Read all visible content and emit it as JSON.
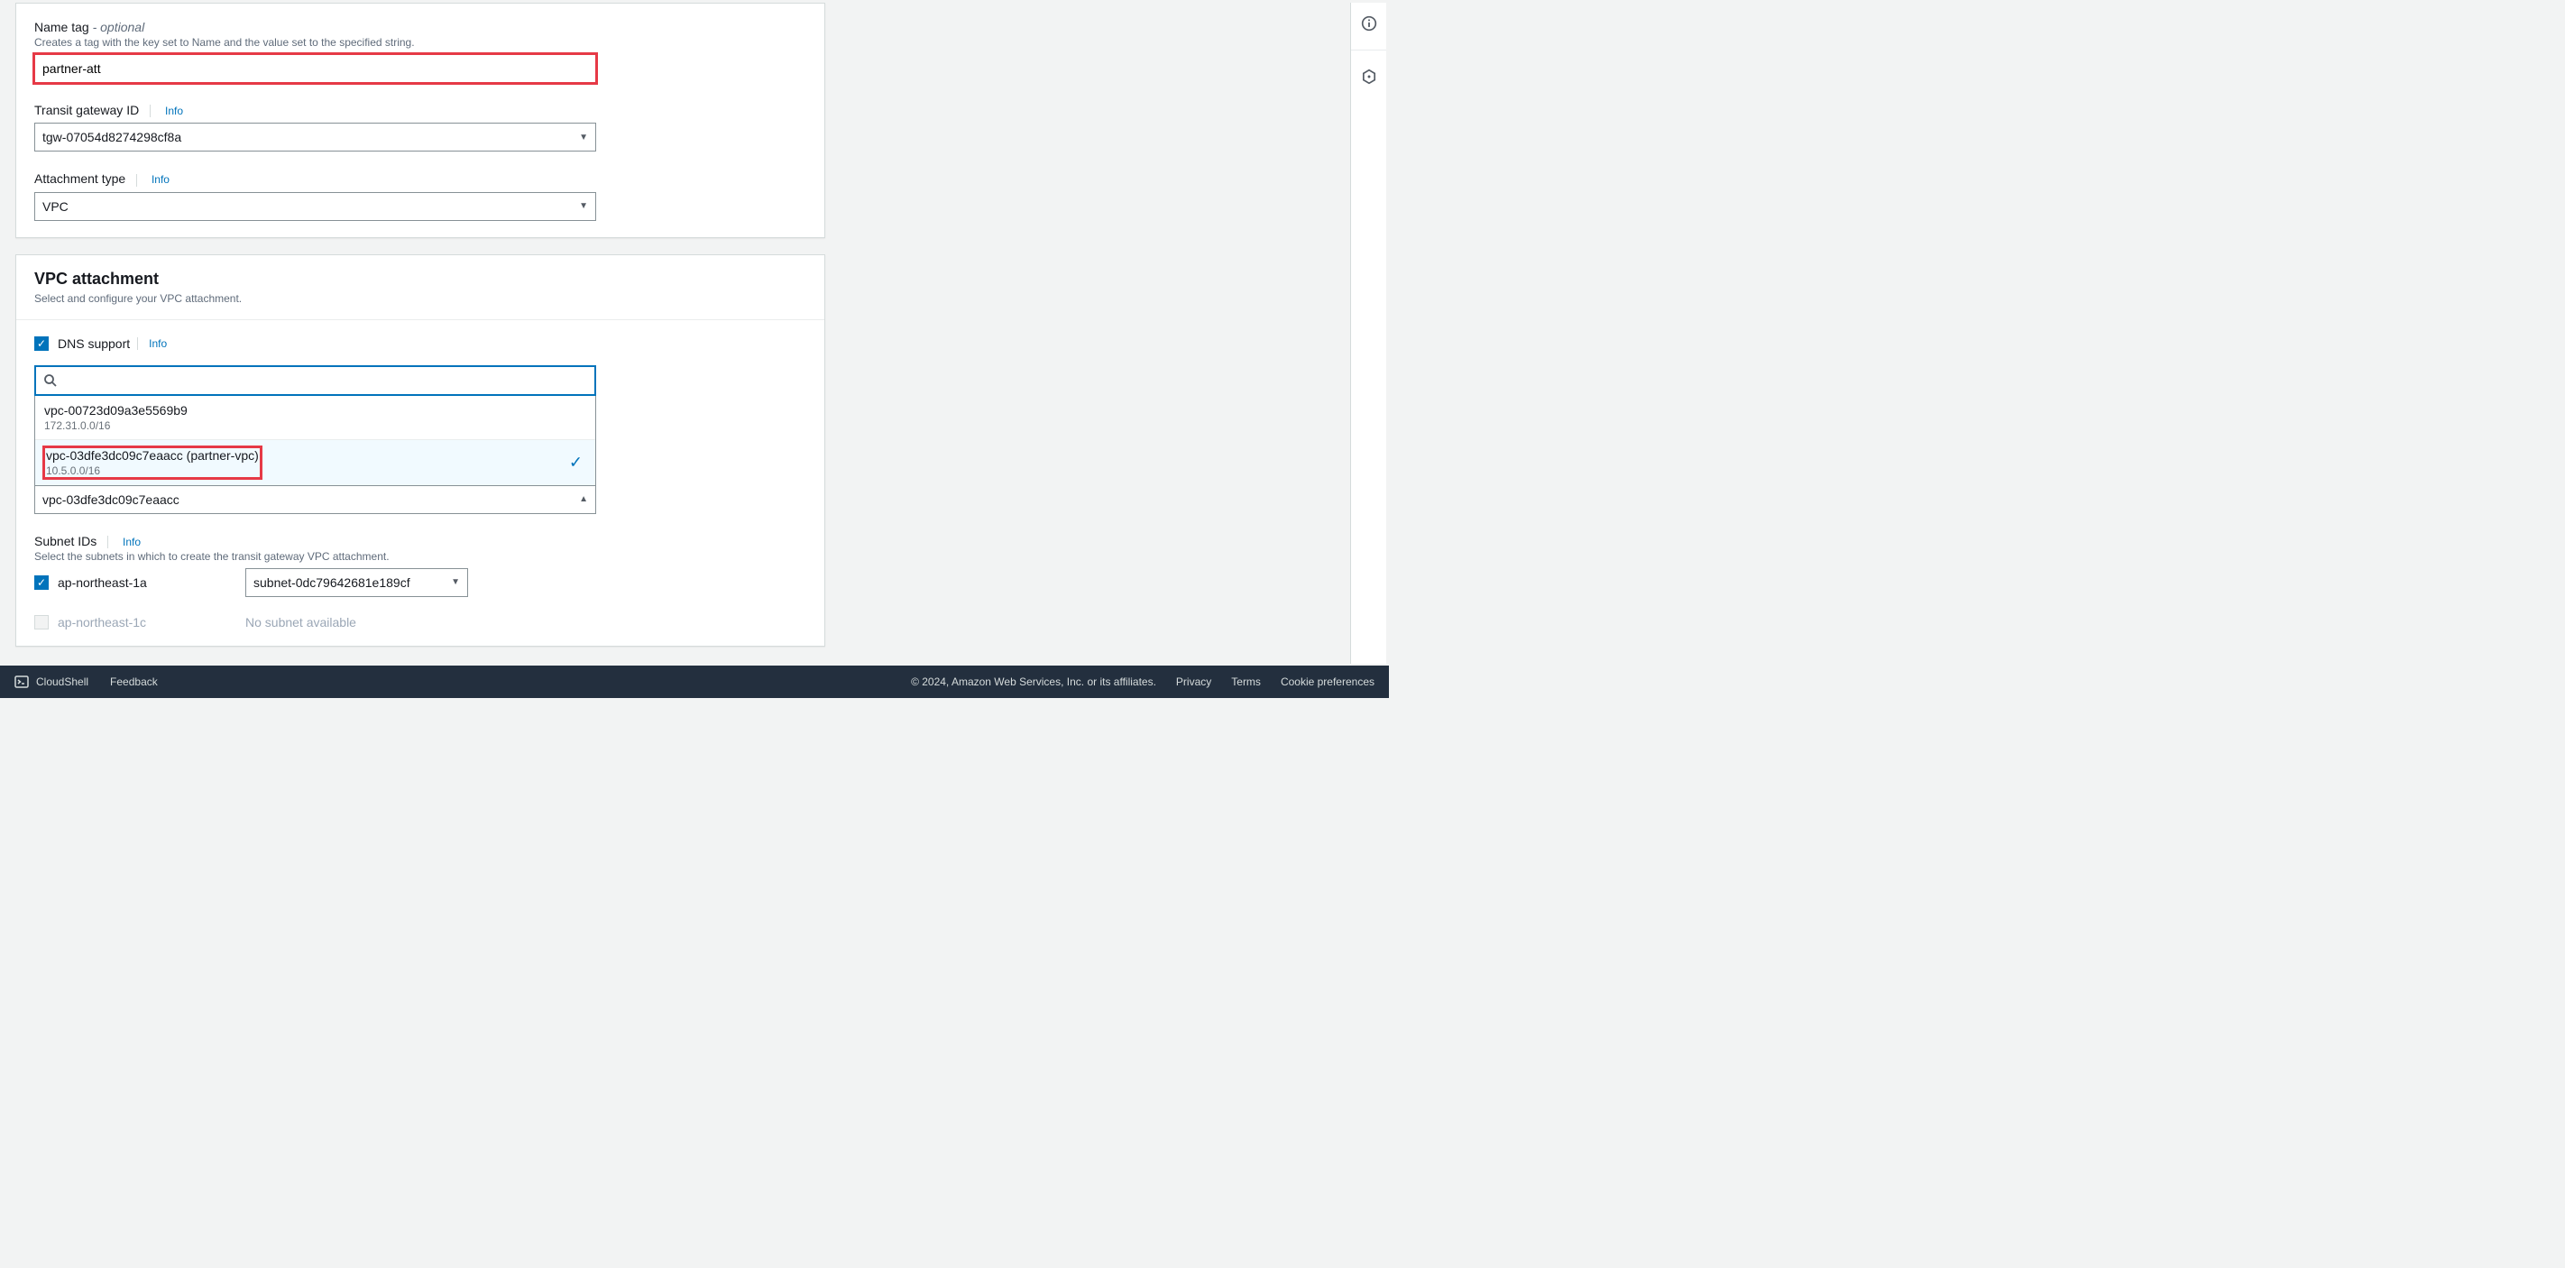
{
  "form": {
    "name_tag": {
      "label": "Name tag",
      "optional": " - optional",
      "helper": "Creates a tag with the key set to Name and the value set to the specified string.",
      "value": "partner-att"
    },
    "transit_gateway": {
      "label": "Transit gateway ID",
      "info": "Info",
      "value": "tgw-07054d8274298cf8a"
    },
    "attachment_type": {
      "label": "Attachment type",
      "info": "Info",
      "value": "VPC"
    }
  },
  "vpc_attachment": {
    "title": "VPC attachment",
    "subtitle": "Select and configure your VPC attachment.",
    "dns_support": {
      "label": "DNS support",
      "info": "Info",
      "checked": true
    },
    "search_placeholder": "",
    "options": [
      {
        "id": "vpc-00723d09a3e5569b9",
        "cidr": "172.31.0.0/16",
        "selected": false
      },
      {
        "id": "vpc-03dfe3dc09c7eaacc (partner-vpc)",
        "cidr": "10.5.0.0/16",
        "selected": true
      }
    ],
    "selected_value": "vpc-03dfe3dc09c7eaacc"
  },
  "subnet": {
    "label": "Subnet IDs",
    "info": "Info",
    "helper": "Select the subnets in which to create the transit gateway VPC attachment.",
    "rows": [
      {
        "az": "ap-northeast-1a",
        "checked": true,
        "available": true,
        "subnet": "subnet-0dc79642681e189cf"
      },
      {
        "az": "ap-northeast-1c",
        "checked": false,
        "available": false,
        "msg": "No subnet available"
      }
    ]
  },
  "footer": {
    "cloudshell": "CloudShell",
    "feedback": "Feedback",
    "copyright": "© 2024, Amazon Web Services, Inc. or its affiliates.",
    "privacy": "Privacy",
    "terms": "Terms",
    "cookies": "Cookie preferences"
  }
}
